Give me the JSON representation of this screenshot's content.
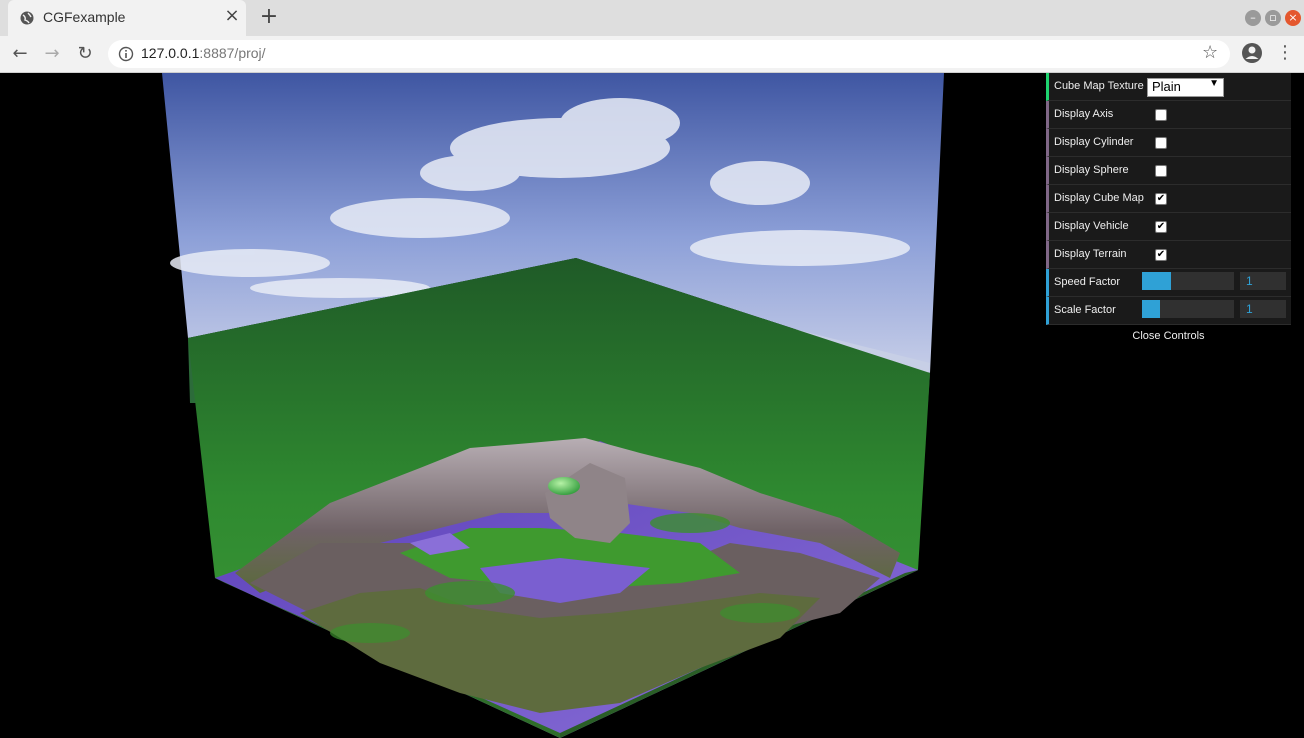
{
  "browser": {
    "tab_title": "CGFexample",
    "url_host": "127.0.0.1",
    "url_rest": ":8887/proj/"
  },
  "gui": {
    "cube_map_texture_label": "Cube Map Texture",
    "cube_map_texture_value": "Plain",
    "display_axis_label": "Display Axis",
    "display_axis_checked": false,
    "display_cylinder_label": "Display Cylinder",
    "display_cylinder_checked": false,
    "display_sphere_label": "Display Sphere",
    "display_sphere_checked": false,
    "display_cube_map_label": "Display Cube Map",
    "display_cube_map_checked": true,
    "display_vehicle_label": "Display Vehicle",
    "display_vehicle_checked": true,
    "display_terrain_label": "Display Terrain",
    "display_terrain_checked": true,
    "speed_factor_label": "Speed Factor",
    "speed_factor_value": "1",
    "speed_factor_fill": 0.32,
    "scale_factor_label": "Scale Factor",
    "scale_factor_value": "1",
    "scale_factor_fill": 0.2,
    "close_controls": "Close Controls"
  },
  "colors": {
    "gui_bg": "#1a1a1a",
    "slider_blue": "#2fa1d6",
    "sky_top": "#4a5fa8",
    "grass": "#2f7d2f",
    "water": "#6b4fc0",
    "rock": "#7a6f70"
  }
}
